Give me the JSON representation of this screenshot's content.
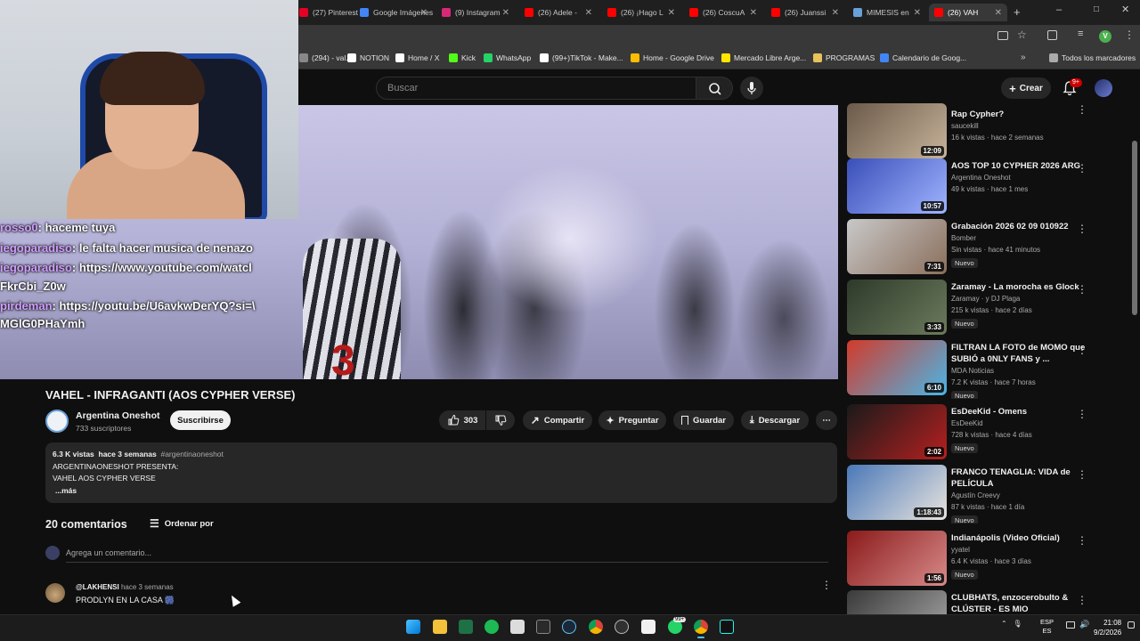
{
  "browser": {
    "tabs": [
      {
        "label": "(27) Pinterest",
        "color": "#e60023"
      },
      {
        "label": "Google Imágenes",
        "color": "#4285f4"
      },
      {
        "label": "(9) Instagram",
        "color": "#d62976"
      },
      {
        "label": "(26) Adele -",
        "color": "#ff0000"
      },
      {
        "label": "(26) ¡Hago L",
        "color": "#ff0000"
      },
      {
        "label": "(26) CoscuA",
        "color": "#ff0000"
      },
      {
        "label": "(26) Juanssi",
        "color": "#ff0000"
      },
      {
        "label": "MIMESIS en",
        "color": "#6aa0d8"
      },
      {
        "label": "(26) VAH",
        "color": "#ff0000"
      }
    ],
    "bookmarks": [
      {
        "label": "(294) - val...",
        "color": "#888888"
      },
      {
        "label": "NOTION",
        "color": "#ffffff"
      },
      {
        "label": "Home / X",
        "color": "#ffffff"
      },
      {
        "label": "Kick",
        "color": "#53fc18"
      },
      {
        "label": "WhatsApp",
        "color": "#25d366"
      },
      {
        "label": "(99+)TikTok - Make...",
        "color": "#ffffff"
      },
      {
        "label": "Home - Google Drive",
        "color": "#fbbc04"
      },
      {
        "label": "Mercado Libre Arge...",
        "color": "#ffe600"
      },
      {
        "label": "PROGRAMAS",
        "color": "#e8c15a"
      },
      {
        "label": "Calendario de Goog...",
        "color": "#4285f4"
      }
    ],
    "all_bookmarks": "Todos los marcadores",
    "profile_letter": "V"
  },
  "header": {
    "search_placeholder": "Buscar",
    "create_label": "Crear",
    "notifications": "9+"
  },
  "chat": [
    {
      "user": "rosso0",
      "text": "haceme tuya"
    },
    {
      "user": "iegoparadiso",
      "text": "le falta hacer musica de nenazo"
    },
    {
      "user": "iegoparadiso",
      "text": "https://www.youtube.com/watcl"
    },
    {
      "user": "",
      "text": "FkrCbi_Z0w"
    },
    {
      "user": "pirdeman",
      "text": "https://youtu.be/U6avkwDerYQ?si=\\"
    },
    {
      "user": "",
      "text": "MGlG0PHaYmh"
    }
  ],
  "video": {
    "jersey_number": "3",
    "title": "VAHEL - INFRAGANTI (AOS CYPHER VERSE)",
    "channel": "Argentina Oneshot",
    "subscribers": "733 suscriptores",
    "subscribe_label": "Suscribirse",
    "likes": "303",
    "share_label": "Compartir",
    "ask_label": "Preguntar",
    "save_label": "Guardar",
    "download_label": "Descargar",
    "description": {
      "views": "6.3 K vistas",
      "time": "hace 3 semanas",
      "tag": "#argentinaoneshot",
      "line1": "ARGENTINAONESHOT PRESENTA:",
      "line2": "VAHEL AOS CYPHER VERSE",
      "more": "...más"
    }
  },
  "comments": {
    "count_label": "20 comentarios",
    "sort_label": "Ordenar por",
    "input_placeholder": "Agrega un comentario...",
    "items": [
      {
        "user": "@LAKHENSI",
        "time": "hace 3 semanas",
        "text": "PRODLYN EN LA CASA 🎆"
      }
    ]
  },
  "recommendations": [
    {
      "title": "Rap Cypher?",
      "channel": "saucekill",
      "meta": "16 k vistas · hace 2 semanas",
      "duration": "12:09",
      "nuevo": "",
      "thumb": [
        "#6b5a4a",
        "#c7b39a"
      ]
    },
    {
      "title": "AOS TOP 10 CYPHER 2026 ARG",
      "channel": "Argentina Oneshot",
      "meta": "49 k vistas · hace 1 mes",
      "duration": "10:57",
      "nuevo": "",
      "thumb": [
        "#3a4fb8",
        "#9fb4ff"
      ]
    },
    {
      "title": "Grabación 2026 02 09 010922",
      "channel": "Bomber",
      "meta": "Sin vistas · hace 41 minutos",
      "duration": "7:31",
      "nuevo": "Nuevo",
      "thumb": [
        "#c8c8c8",
        "#8a6f5c"
      ]
    },
    {
      "title": "Zaramay - La morocha es Glock",
      "channel": "Zaramay · y DJ Plaga",
      "meta": "215 k vistas · hace 2 días",
      "duration": "3:33",
      "nuevo": "Nuevo",
      "thumb": [
        "#2d3a2a",
        "#6c7a5c"
      ]
    },
    {
      "title": "FILTRAN LA FOTO de MOMO que SUBIÓ a 0NLY FANS y ...",
      "channel": "MDA Noticias",
      "meta": "7.2 K vistas · hace 7 horas",
      "duration": "6:10",
      "nuevo": "Nuevo",
      "thumb": [
        "#d23a2a",
        "#4ab6e6"
      ]
    },
    {
      "title": "EsDeeKid - Omens",
      "channel": "EsDeeKid",
      "meta": "728 k vistas · hace 4 días",
      "duration": "2:02",
      "nuevo": "Nuevo",
      "thumb": [
        "#1a1a1a",
        "#b52020"
      ]
    },
    {
      "title": "FRANCO TENAGLIA: VIDA de PELÍCULA",
      "channel": "Agustín Creevy",
      "meta": "87 k vistas · hace 1 día",
      "duration": "1:18:43",
      "nuevo": "Nuevo",
      "thumb": [
        "#4a78b8",
        "#e8e4de"
      ]
    },
    {
      "title": "Indianápolis (Video Oficial)",
      "channel": "yyatel",
      "meta": "6.4 K vistas · hace 3 días",
      "duration": "1:56",
      "nuevo": "Nuevo",
      "thumb": [
        "#8a1a1a",
        "#d88a8a"
      ]
    },
    {
      "title": "CLUBHATS, enzocerobulto & CLÚSTER - ES MIO",
      "channel": "",
      "meta": "",
      "duration": "",
      "nuevo": "",
      "thumb": [
        "#3a3a3a",
        "#a8a8a8"
      ]
    }
  ],
  "taskbar": {
    "lang_top": "ESP",
    "lang_bottom": "ES",
    "time": "21:08",
    "date": "9/2/2026",
    "whatsapp_badge": "99+"
  }
}
